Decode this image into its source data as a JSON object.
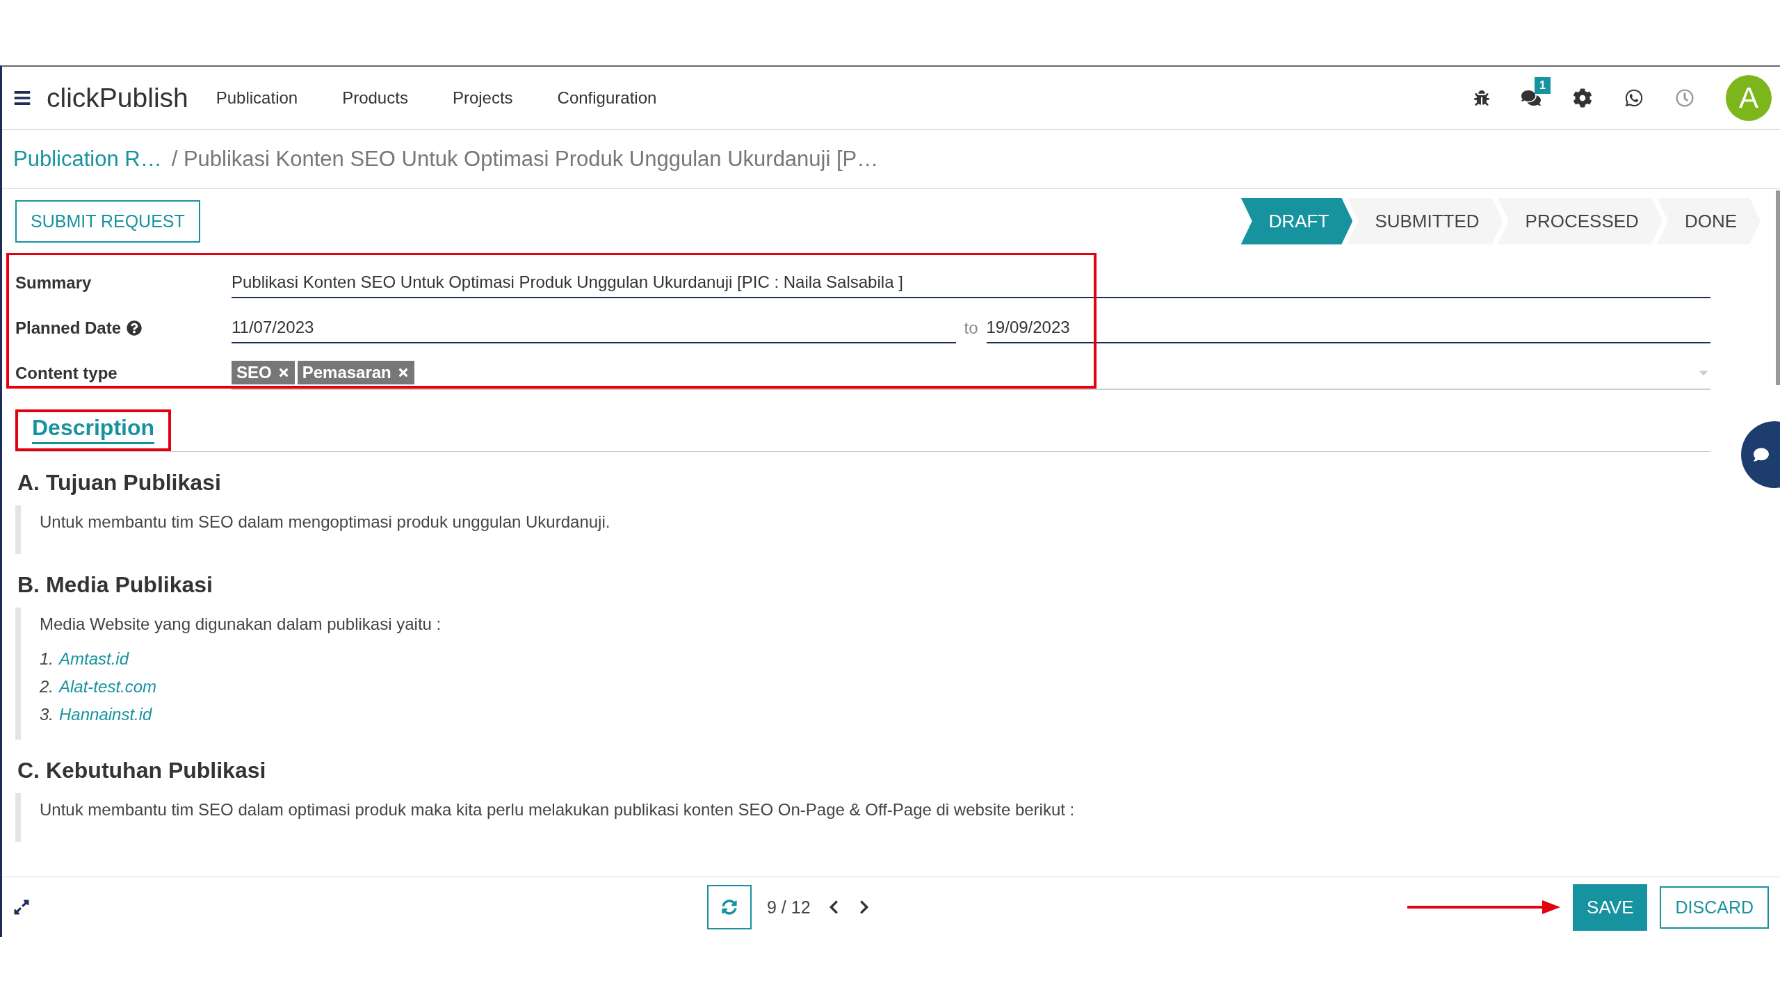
{
  "navbar": {
    "app_name": "clickPublish",
    "menu": [
      {
        "label": "Publication"
      },
      {
        "label": "Products"
      },
      {
        "label": "Projects"
      },
      {
        "label": "Configuration"
      }
    ],
    "message_count": "1",
    "avatar_initial": "A"
  },
  "breadcrumb": [
    {
      "label": "Publication R…",
      "link": true
    },
    {
      "label": "/ Publikasi Konten SEO Untuk Optimasi Produk Unggulan Ukurdanuji [P…",
      "link": false
    }
  ],
  "action_button": "SUBMIT REQUEST",
  "stages": [
    {
      "label": "DRAFT",
      "selected": true
    },
    {
      "label": "SUBMITTED",
      "selected": false
    },
    {
      "label": "PROCESSED",
      "selected": false
    },
    {
      "label": "DONE",
      "selected": false
    }
  ],
  "fields": [
    {
      "kind": "text",
      "label": "Summary",
      "value": "Publikasi Konten SEO Untuk Optimasi Produk Unggulan Ukurdanuji [PIC : Naila Salsabila ]"
    },
    {
      "kind": "daterange",
      "label": "Planned Date",
      "value": "11/07/2023",
      "separator": "to",
      "end_value": "19/09/2023"
    },
    {
      "kind": "tags",
      "label": "Content type",
      "tags": [
        "SEO",
        "Pemasaran"
      ]
    }
  ],
  "tabs": [
    {
      "label": "Description",
      "selected": true
    }
  ],
  "description": [
    {
      "heading": "A. Tujuan Publikasi",
      "blocks": [
        {
          "kind": "paragraph",
          "text": "Untuk membantu tim SEO dalam mengoptimasi produk unggulan Ukurdanuji."
        }
      ]
    },
    {
      "heading": "B. Media Publikasi",
      "blocks": [
        {
          "kind": "paragraph",
          "text": "Media Website yang digunakan dalam publikasi yaitu :"
        },
        {
          "kind": "list",
          "items": [
            {
              "number": "1.",
              "text": "Amtast.id"
            },
            {
              "number": "2.",
              "text": "Alat-test.com"
            },
            {
              "number": "3.",
              "text": "Hannainst.id"
            }
          ]
        }
      ]
    },
    {
      "heading": "C. Kebutuhan Publikasi",
      "blocks": [
        {
          "kind": "paragraph",
          "text": "Untuk membantu tim SEO dalam optimasi produk maka kita perlu melakukan publikasi konten SEO On-Page & Off-Page di website berikut :"
        }
      ]
    }
  ],
  "pager": "9 / 12",
  "footer_buttons": {
    "save": "SAVE",
    "discard": "DISCARD"
  }
}
